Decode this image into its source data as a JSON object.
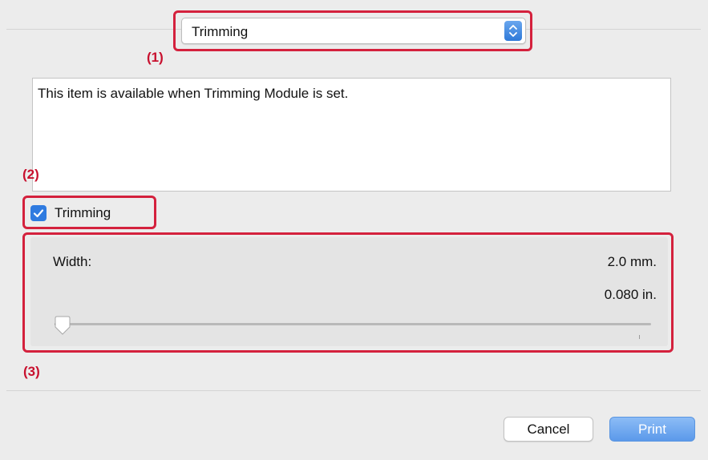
{
  "popup": {
    "selected": "Trimming"
  },
  "callouts": {
    "one": "(1)",
    "two": "(2)",
    "three": "(3)"
  },
  "description": {
    "text": "This item is available when Trimming Module is set."
  },
  "trimming_checkbox": {
    "label": "Trimming",
    "checked": true
  },
  "width": {
    "label": "Width:",
    "value_mm": "2.0 mm.",
    "value_in": "0.080 in.",
    "slider_fraction": 0.0
  },
  "buttons": {
    "cancel": "Cancel",
    "print": "Print"
  },
  "colors": {
    "accent": "#2f7be0",
    "callout": "#d4213d"
  }
}
